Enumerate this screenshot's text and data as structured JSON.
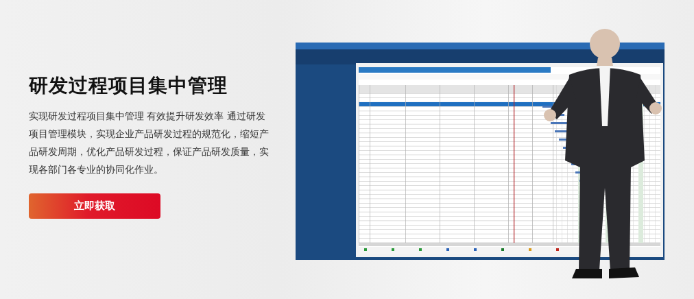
{
  "hero": {
    "title": "研发过程项目集中管理",
    "description": "实现研发过程项目集中管理 有效提升研发效率 通过研发项目管理模块，实现企业产品研发过程的规范化，缩短产品研发周期，优化产品研发过程，保证产品研发质量，实现各部门各专业的协同化作业。",
    "cta": "立即获取"
  }
}
